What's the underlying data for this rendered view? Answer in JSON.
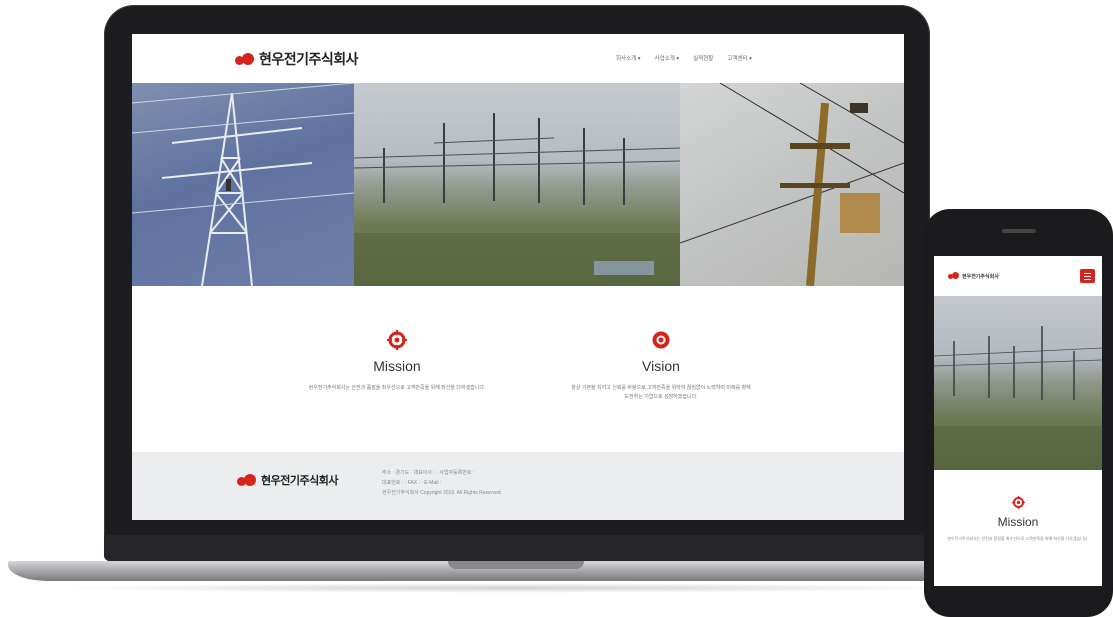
{
  "site": {
    "logo_text": "현우전기주식회사",
    "brand_color": "#d7231b",
    "nav": [
      {
        "label": "회사소개 ▾"
      },
      {
        "label": "사업소개 ▾"
      },
      {
        "label": "실적현황"
      },
      {
        "label": "고객센터 ▾"
      }
    ]
  },
  "mission": {
    "icon": "mission-target-icon",
    "title": "Mission",
    "description": "현우전기주식회사는 안전과 품질을 최우선으로 고객만족을 위해 최선을 다하겠습니다."
  },
  "vision": {
    "icon": "vision-gear-icon",
    "title": "Vision",
    "description_line1": "항상 기본을 지키고 신뢰를 바탕으로 고객만족을 위하여 끊임없이 노력하며 미래를 향해",
    "description_line2": "도전하는 기업으로 성장하겠습니다."
  },
  "footer": {
    "logo_text": "현우전기주식회사",
    "info_line1": "주소 : 경기도 · 대표이사 : · 사업자등록번호 :",
    "info_line2": "대표번호 : · FAX : · E-Mail :",
    "info_line3": "현우전기주식회사 Copyright 2019. All Rights Reserved."
  },
  "mobile": {
    "logo_text": "현우전기주식회사",
    "menu_icon": "hamburger-menu-icon",
    "section_title": "Mission",
    "section_description": "현우전기주식회사는 안전과 품질을 최우선으로 고객만족을 위해 최선을 다하겠습니다."
  }
}
